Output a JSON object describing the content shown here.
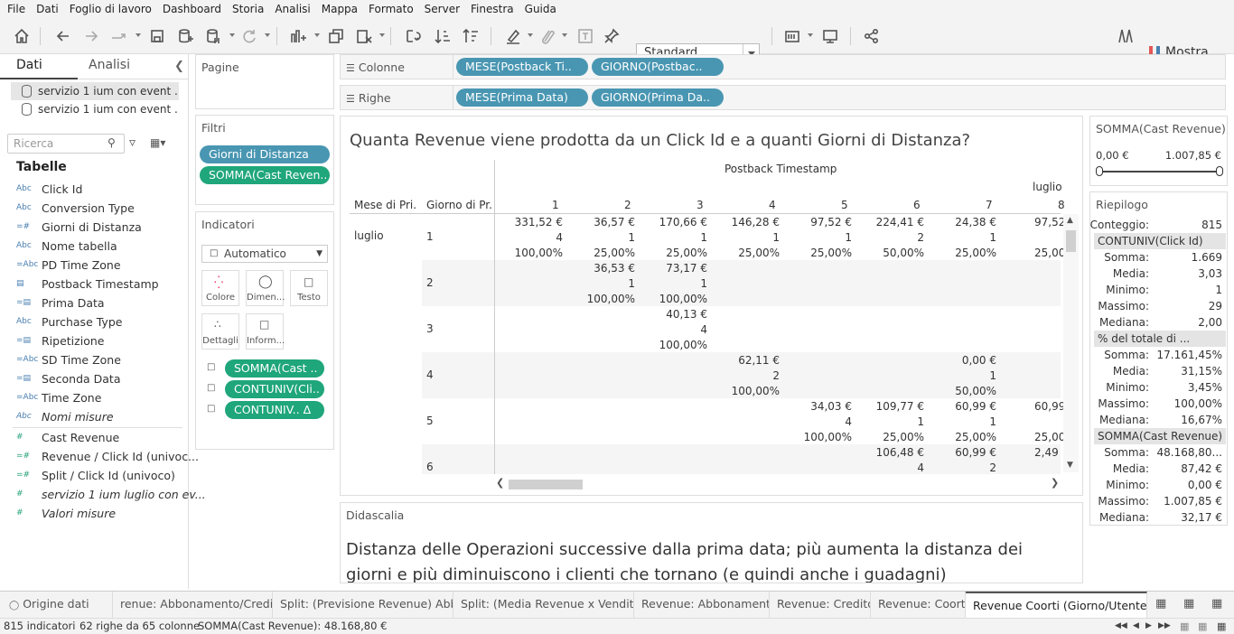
{
  "menu": [
    "File",
    "Dati",
    "Foglio di lavoro",
    "Dashboard",
    "Storia",
    "Analisi",
    "Mappa",
    "Formato",
    "Server",
    "Finestra",
    "Guida"
  ],
  "toolbar": {
    "format_select": "Standard",
    "show_label": "Mostra"
  },
  "left_panel": {
    "tab_data": "Dati",
    "tab_analytics": "Analisi",
    "datasources": [
      "servizio 1 ium con event ...",
      "servizio 1 ium con event ..."
    ],
    "search_placeholder": "Ricerca",
    "tables_title": "Tabelle",
    "fields": [
      {
        "type": "Abc",
        "name": "Click Id"
      },
      {
        "type": "Abc",
        "name": "Conversion Type"
      },
      {
        "type": "=#",
        "name": "Giorni di Distanza"
      },
      {
        "type": "Abc",
        "name": "Nome tabella"
      },
      {
        "type": "=Abc",
        "name": "PD Time Zone"
      },
      {
        "type": "date",
        "name": "Postback Timestamp"
      },
      {
        "type": "=date",
        "name": "Prima Data"
      },
      {
        "type": "Abc",
        "name": "Purchase Type"
      },
      {
        "type": "=date",
        "name": "Ripetizione"
      },
      {
        "type": "=Abc",
        "name": "SD Time Zone"
      },
      {
        "type": "=date",
        "name": "Seconda Data"
      },
      {
        "type": "=Abc",
        "name": "Time Zone"
      },
      {
        "type": "Abc",
        "name": "Nomi misure"
      }
    ],
    "measures": [
      {
        "type": "#",
        "name": "Cast Revenue"
      },
      {
        "type": "=#",
        "name": "Revenue / Click Id (univoc..."
      },
      {
        "type": "=#",
        "name": "Split / Click Id (univoco)"
      },
      {
        "type": "#",
        "name": "servizio 1 ium luglio con ev..."
      },
      {
        "type": "#",
        "name": "Valori misure"
      }
    ]
  },
  "pages": {
    "title": "Pagine"
  },
  "filters": {
    "title": "Filtri",
    "pills": [
      "Giorni di Distanza",
      "SOMMA(Cast Reven.."
    ]
  },
  "marks": {
    "title": "Indicatori",
    "type": "Automatico",
    "buttons": [
      "Colore",
      "Dimen...",
      "Testo",
      "Dettagli",
      "Inform..."
    ],
    "pills": [
      "SOMMA(Cast ..",
      "CONTUNIV(Cli..",
      "CONTUNIV..  Δ"
    ]
  },
  "columns_shelf": {
    "label": "Colonne",
    "pills": [
      "MESE(Postback Ti..",
      "GIORNO(Postbac.."
    ]
  },
  "rows_shelf": {
    "label": "Righe",
    "pills": [
      "MESE(Prima Data)",
      "GIORNO(Prima Da.."
    ]
  },
  "viz": {
    "title": "Quanta Revenue viene prodotta da un Click Id e a quanti Giorni di Distanza?",
    "col_header_top": "Postback Timestamp",
    "col_month": "luglio",
    "row_headers": [
      "Mese di Pri..",
      "Giorno di Pr..."
    ],
    "row_month": "luglio",
    "col_days": [
      "1",
      "2",
      "3",
      "4",
      "5",
      "6",
      "7",
      "8"
    ],
    "rows": [
      {
        "day": "1",
        "cells": [
          "331,52 €\n4\n100,00%",
          "36,57 €\n1\n25,00%",
          "170,66 €\n1\n25,00%",
          "146,28 €\n1\n25,00%",
          "97,52 €\n1\n25,00%",
          "224,41 €\n2\n50,00%",
          "24,38 €\n1\n25,00%",
          "97,52\n\n25,00"
        ]
      },
      {
        "day": "2",
        "cells": [
          "",
          "36,53 €\n1\n100,00%",
          "73,17 €\n1\n100,00%",
          "",
          "",
          "",
          "",
          ""
        ]
      },
      {
        "day": "3",
        "cells": [
          "",
          "",
          "40,13 €\n4\n100,00%",
          "",
          "",
          "",
          "",
          ""
        ]
      },
      {
        "day": "4",
        "cells": [
          "",
          "",
          "",
          "62,11 €\n2\n100,00%",
          "",
          "",
          "0,00 €\n1\n50,00%",
          ""
        ]
      },
      {
        "day": "5",
        "cells": [
          "",
          "",
          "",
          "",
          "34,03 €\n4\n100,00%",
          "109,77 €\n1\n25,00%",
          "60,99 €\n1\n25,00%",
          "60,99\n\n25,00"
        ]
      },
      {
        "day": "6",
        "cells": [
          "",
          "",
          "",
          "",
          "",
          "106,48 €\n4",
          "60,99 €\n2",
          "2,49"
        ]
      }
    ]
  },
  "caption": {
    "title": "Didascalia",
    "text": "Distanza delle Operazioni successive dalla prima data; più aumenta la distanza dei giorni e più diminuiscono i clienti che tornano (e quindi anche i guadagni)"
  },
  "legend": {
    "title": "SOMMA(Cast Revenue)",
    "min": "0,00 €",
    "max": "1.007,85 €"
  },
  "summary": {
    "title": "Riepilogo",
    "count_label": "Conteggio:",
    "count": "815",
    "groups": [
      {
        "name": "CONTUNIV(Click Id)",
        "rows": [
          [
            "Somma:",
            "1.669"
          ],
          [
            "Media:",
            "3,03"
          ],
          [
            "Minimo:",
            "1"
          ],
          [
            "Massimo:",
            "29"
          ],
          [
            "Mediana:",
            "2,00"
          ]
        ]
      },
      {
        "name": "% del totale di ...",
        "rows": [
          [
            "Somma:",
            "17.161,45%"
          ],
          [
            "Media:",
            "31,15%"
          ],
          [
            "Minimo:",
            "3,45%"
          ],
          [
            "Massimo:",
            "100,00%"
          ],
          [
            "Mediana:",
            "16,67%"
          ]
        ]
      },
      {
        "name": "SOMMA(Cast Revenue)",
        "rows": [
          [
            "Somma:",
            "48.168,80..."
          ],
          [
            "Media:",
            "87,42 €"
          ],
          [
            "Minimo:",
            "0,00 €"
          ],
          [
            "Massimo:",
            "1.007,85 €"
          ],
          [
            "Mediana:",
            "32,17 €"
          ]
        ]
      }
    ]
  },
  "sheet_tabs": {
    "source": "Origine dati",
    "tabs": [
      "renue: Abbonamento/Credit...",
      "Split: (Previsione Revenue) Abb...",
      "Split: (Media Revenue x Vendita)...",
      "Revenue: Abbonamento",
      "Revenue: Credito",
      "Revenue: Coorti",
      "Revenue Coorti (Giorno/Utente)"
    ]
  },
  "status": {
    "marks": "815 indicatori",
    "dims": "62 righe da 65 colonne",
    "sum": "SOMMA(Cast Revenue): 48.168,80 €"
  },
  "colors": {
    "dim_pill": "#4996b2",
    "measure_pill": "#1fa67a"
  }
}
